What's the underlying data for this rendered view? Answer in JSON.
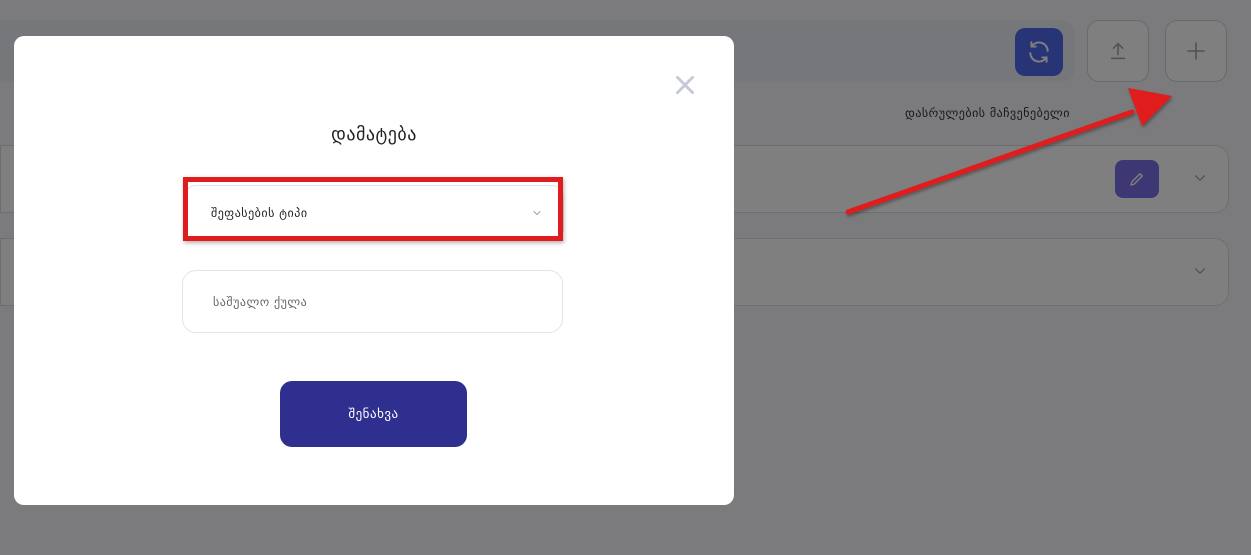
{
  "background": {
    "column_label": "დასრულების მაჩვენებელი",
    "icons": {
      "refresh": "refresh-icon",
      "upload": "upload-icon",
      "add": "plus-icon",
      "edit": "pencil-icon",
      "expand": "chevron-down-icon"
    }
  },
  "modal": {
    "title": "დამატება",
    "type_select": {
      "selected": "შეფასების ტიპი"
    },
    "average_score_input": {
      "placeholder": "საშუალო ქულა",
      "value": ""
    },
    "save_label": "შენახვა"
  },
  "colors": {
    "accent": "#4f6bed",
    "primary_button": "#2e2f8f",
    "edit_button": "#7b6ee8",
    "annotation": "#e01c1c"
  }
}
